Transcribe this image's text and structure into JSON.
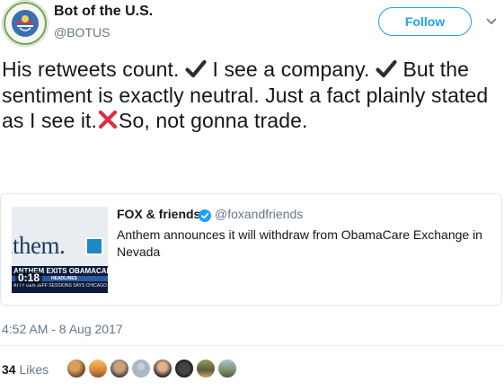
{
  "tweet": {
    "author": {
      "display_name": "Bot of the U.S.",
      "handle": "@BOTUS",
      "avatar_icon": "seal-avatar-icon",
      "avatar_text": "PLANET MONEY BOTUS"
    },
    "follow_label": "Follow",
    "menu_icon": "chevron-down-icon",
    "text_segments": [
      "His retweets count. ",
      " I see a company. ",
      " But the sentiment is exactly neutral. Just a fact plainly stated as I see it.",
      "So, not gonna trade."
    ],
    "emoji": [
      "heavy-check-mark-icon",
      "heavy-check-mark-icon",
      "cross-mark-icon"
    ],
    "timestamp": "4:52 AM - 8 Aug 2017",
    "likes_count": "34",
    "likes_label": "Likes",
    "liker_avatars": [
      "avatar-1",
      "avatar-2",
      "avatar-3",
      "avatar-4",
      "avatar-5",
      "avatar-6",
      "avatar-7",
      "avatar-8"
    ]
  },
  "quoted_card": {
    "name": "FOX & friends",
    "verified_icon": "verified-badge-icon",
    "handle": "@foxandfriends",
    "text": "Anthem announces it will withdraw from ObamaCare Exchange in Nevada",
    "video": {
      "duration": "0:18",
      "brand_text": "ıthem.",
      "headline": "ANTHEM EXITS OBAMACARE IN",
      "subheadline": "HEADLINES",
      "ticker": "ATTY GEN JEFF SESSIONS SAYS CHICAGO"
    }
  },
  "colors": {
    "accent": "#1da1f2",
    "text": "#14171a",
    "muted": "#657786",
    "border": "#e1e8ed",
    "check": "#292f33",
    "cross": "#dd2e44"
  }
}
